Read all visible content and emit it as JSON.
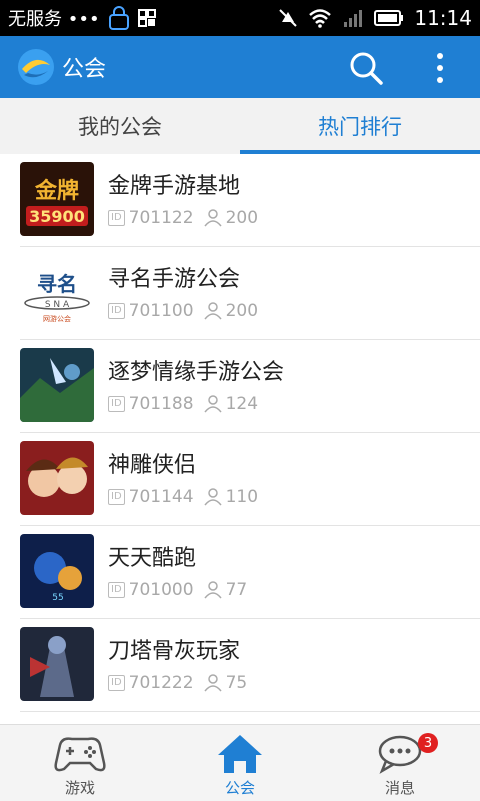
{
  "status": {
    "carrier": "无服务 •••",
    "time": "11:14"
  },
  "appbar": {
    "title": "公会"
  },
  "tabs": [
    {
      "label": "我的公会",
      "active": false
    },
    {
      "label": "热门排行",
      "active": true
    }
  ],
  "guilds": [
    {
      "name": "金牌手游基地",
      "id": "701122",
      "members": "200",
      "thumb_text": "金牌 35900"
    },
    {
      "name": "寻名手游公会",
      "id": "701100",
      "members": "200",
      "thumb_text": "寻名 SNA 网游公会"
    },
    {
      "name": "逐梦情缘手游公会",
      "id": "701188",
      "members": "124"
    },
    {
      "name": "神雕侠侣",
      "id": "701144",
      "members": "110"
    },
    {
      "name": "天天酷跑",
      "id": "701000",
      "members": "77"
    },
    {
      "name": "刀塔骨灰玩家",
      "id": "701222",
      "members": "75"
    }
  ],
  "id_badge": "ID",
  "bottom_nav": [
    {
      "label": "游戏",
      "icon": "gamepad-icon"
    },
    {
      "label": "公会",
      "icon": "home-icon",
      "active": true
    },
    {
      "label": "消息",
      "icon": "chat-icon",
      "badge": "3"
    }
  ]
}
